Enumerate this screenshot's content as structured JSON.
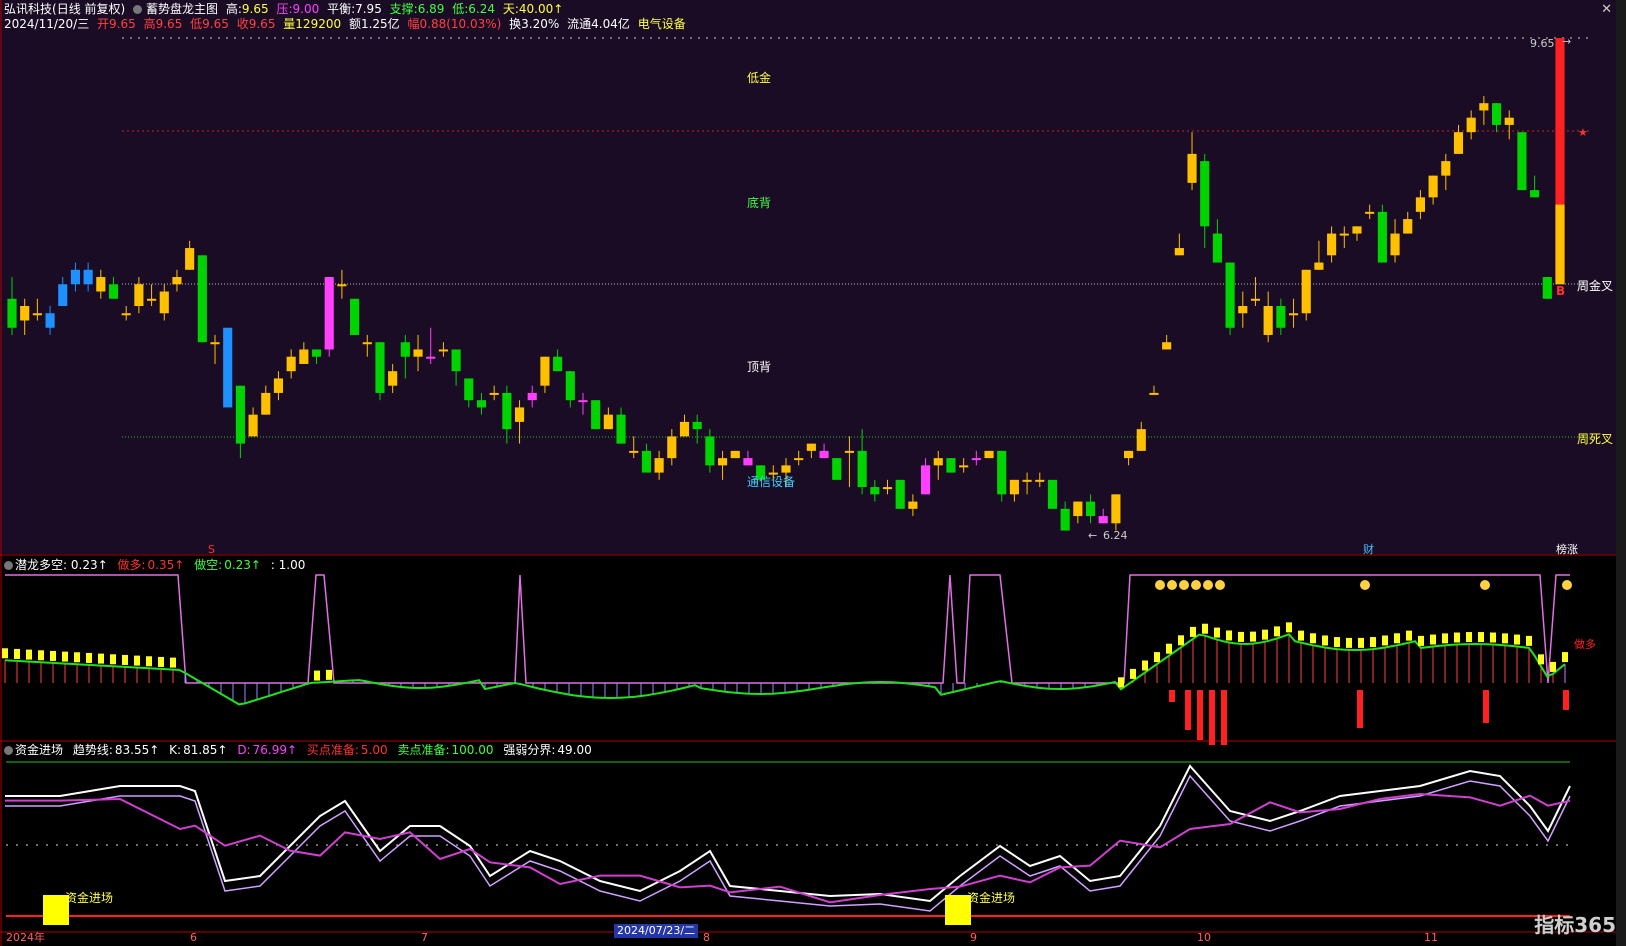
{
  "window": {
    "stock_name": "弘讯科技",
    "period": "(日线 前复权)",
    "indicator_name": "蓄势盘龙主图",
    "close_icon": "close-icon"
  },
  "header_line1": {
    "high_label": "高:",
    "high_value": "9.65",
    "press_label": "压:",
    "press_value": "9.00",
    "balance_label": "平衡:",
    "balance_value": "7.95",
    "support_label": "支撑:",
    "support_value": "6.89",
    "low_label": "低:",
    "low_value": "6.24",
    "sky_label": "天:",
    "sky_value": "40.00↑"
  },
  "header_line2": {
    "date": "2024/11/20/三",
    "open": "开9.65",
    "high": "高9.65",
    "low": "低9.65",
    "close": "收9.65",
    "volume": "量129200",
    "amount": "额1.25亿",
    "change": "幅0.88(10.03%)",
    "turnover": "换3.20%",
    "float": "流通4.04亿",
    "sector": "电气设备"
  },
  "main_labels": {
    "low_gold": "低金",
    "bottom_div": "底背",
    "top_div": "顶背",
    "sector_tag": "通信设备",
    "week_gold_cross": "周金叉",
    "week_death_cross": "周死叉",
    "max_price": "9.65",
    "min_price": "6.24",
    "buy_mark": "B",
    "low_mark": "S",
    "fin_mark": "财",
    "rank_mark": "榜涨"
  },
  "panel2": {
    "name": "潜龙多空",
    "value": ": 0.23↑",
    "long_label": "做多:",
    "long_value": "0.35↑",
    "short_label": "做空:",
    "short_value": "0.23↑",
    "ref_value": ": 1.00",
    "long_marker": "做多"
  },
  "panel3": {
    "name": "资金进场",
    "trend_label": "趋势线:",
    "trend_value": "83.55↑",
    "k_label": "K:",
    "k_value": "81.85↑",
    "d_label": "D:",
    "d_value": "76.99↑",
    "buy_label": "买点准备:",
    "buy_value": "5.00",
    "sell_label": "卖点准备:",
    "sell_value": "100.00",
    "strength_label": "强弱分界:",
    "strength_value": "49.00",
    "entry_label_1": "资金进场",
    "entry_label_2": "资金进场"
  },
  "x_axis": {
    "labels": [
      "2024年",
      "6",
      "7",
      "8",
      "9",
      "10",
      "11"
    ],
    "selected_date": "2024/07/23/二"
  },
  "watermark": "指标365",
  "colors": {
    "up_yellow": "#ffc000",
    "down_green": "#00d400",
    "magenta": "#ff40ff",
    "blue": "#1e90ff",
    "red": "#ff2020",
    "bg_main": "#1a0c24"
  },
  "chart_data": {
    "type": "candlestick",
    "price_range": [
      6.24,
      9.65
    ],
    "reference_lines": {
      "pressure": 9.0,
      "balance": 7.95,
      "support": 6.89
    },
    "candles_ohlc_approx": [
      [
        7.85,
        8.0,
        7.6,
        7.65
      ],
      [
        7.7,
        7.85,
        7.6,
        7.8
      ],
      [
        7.75,
        7.85,
        7.7,
        7.75
      ],
      [
        7.75,
        7.8,
        7.6,
        7.65
      ],
      [
        7.8,
        8.0,
        7.8,
        7.95
      ],
      [
        7.95,
        8.1,
        7.9,
        8.05
      ],
      [
        8.05,
        8.1,
        7.9,
        7.95
      ],
      [
        7.9,
        8.05,
        7.85,
        8.0
      ],
      [
        7.95,
        8.0,
        7.85,
        7.85
      ],
      [
        7.75,
        7.8,
        7.7,
        7.75
      ],
      [
        7.8,
        8.0,
        7.75,
        7.95
      ],
      [
        7.85,
        7.95,
        7.8,
        7.85
      ],
      [
        7.75,
        7.95,
        7.7,
        7.9
      ],
      [
        7.95,
        8.05,
        7.9,
        8.0
      ],
      [
        8.05,
        8.25,
        8.05,
        8.2
      ],
      [
        8.15,
        8.15,
        7.55,
        7.55
      ],
      [
        7.55,
        7.6,
        7.4,
        7.55
      ],
      [
        7.65,
        7.65,
        7.1,
        7.1
      ],
      [
        7.25,
        7.25,
        6.75,
        6.85
      ],
      [
        6.9,
        7.1,
        6.9,
        7.05
      ],
      [
        7.05,
        7.25,
        7.05,
        7.2
      ],
      [
        7.2,
        7.35,
        7.15,
        7.3
      ],
      [
        7.35,
        7.5,
        7.3,
        7.45
      ],
      [
        7.4,
        7.55,
        7.4,
        7.5
      ],
      [
        7.5,
        7.5,
        7.4,
        7.45
      ],
      [
        7.5,
        8.0,
        7.45,
        8.0
      ],
      [
        7.95,
        8.05,
        7.85,
        7.95
      ],
      [
        7.85,
        7.85,
        7.6,
        7.6
      ],
      [
        7.55,
        7.6,
        7.45,
        7.55
      ],
      [
        7.55,
        7.55,
        7.15,
        7.2
      ],
      [
        7.25,
        7.4,
        7.2,
        7.35
      ],
      [
        7.55,
        7.6,
        7.3,
        7.45
      ],
      [
        7.45,
        7.6,
        7.35,
        7.5
      ],
      [
        7.45,
        7.65,
        7.4,
        7.45
      ],
      [
        7.5,
        7.55,
        7.45,
        7.5
      ],
      [
        7.5,
        7.5,
        7.25,
        7.35
      ],
      [
        7.3,
        7.3,
        7.1,
        7.15
      ],
      [
        7.15,
        7.2,
        7.05,
        7.1
      ],
      [
        7.2,
        7.25,
        7.15,
        7.2
      ],
      [
        7.2,
        7.25,
        6.85,
        6.95
      ],
      [
        7.0,
        7.15,
        6.85,
        7.1
      ],
      [
        7.15,
        7.25,
        7.1,
        7.2
      ],
      [
        7.25,
        7.45,
        7.2,
        7.45
      ],
      [
        7.45,
        7.5,
        7.35,
        7.35
      ],
      [
        7.35,
        7.35,
        7.1,
        7.15
      ],
      [
        7.15,
        7.2,
        7.05,
        7.15
      ],
      [
        7.15,
        7.15,
        6.95,
        6.95
      ],
      [
        6.95,
        7.1,
        6.95,
        7.05
      ],
      [
        7.05,
        7.1,
        6.85,
        6.85
      ],
      [
        6.8,
        6.9,
        6.75,
        6.8
      ],
      [
        6.8,
        6.85,
        6.7,
        6.65
      ],
      [
        6.65,
        6.8,
        6.6,
        6.75
      ],
      [
        6.75,
        6.95,
        6.7,
        6.9
      ],
      [
        6.9,
        7.05,
        6.9,
        7.0
      ],
      [
        7.0,
        7.05,
        6.85,
        6.95
      ],
      [
        6.9,
        6.95,
        6.65,
        6.7
      ],
      [
        6.7,
        6.8,
        6.6,
        6.75
      ],
      [
        6.75,
        6.8,
        6.75,
        6.8
      ],
      [
        6.75,
        6.8,
        6.7,
        6.7
      ],
      [
        6.7,
        6.7,
        6.6,
        6.6
      ],
      [
        6.65,
        6.7,
        6.6,
        6.65
      ],
      [
        6.65,
        6.75,
        6.55,
        6.7
      ],
      [
        6.75,
        6.8,
        6.7,
        6.75
      ],
      [
        6.8,
        6.85,
        6.75,
        6.85
      ],
      [
        6.8,
        6.85,
        6.75,
        6.75
      ],
      [
        6.75,
        6.75,
        6.6,
        6.6
      ],
      [
        6.8,
        6.9,
        6.55,
        6.8
      ],
      [
        6.8,
        6.95,
        6.5,
        6.55
      ],
      [
        6.55,
        6.6,
        6.45,
        6.5
      ],
      [
        6.55,
        6.6,
        6.5,
        6.55
      ],
      [
        6.6,
        6.6,
        6.4,
        6.4
      ],
      [
        6.4,
        6.5,
        6.35,
        6.45
      ],
      [
        6.5,
        6.75,
        6.5,
        6.7
      ],
      [
        6.7,
        6.8,
        6.6,
        6.75
      ],
      [
        6.75,
        6.75,
        6.65,
        6.65
      ],
      [
        6.7,
        6.75,
        6.65,
        6.7
      ],
      [
        6.75,
        6.8,
        6.7,
        6.75
      ],
      [
        6.75,
        6.8,
        6.75,
        6.8
      ],
      [
        6.8,
        6.8,
        6.45,
        6.5
      ],
      [
        6.5,
        6.6,
        6.45,
        6.6
      ],
      [
        6.6,
        6.65,
        6.5,
        6.6
      ],
      [
        6.6,
        6.65,
        6.55,
        6.6
      ],
      [
        6.6,
        6.6,
        6.4,
        6.4
      ],
      [
        6.4,
        6.45,
        6.25,
        6.25
      ],
      [
        6.35,
        6.45,
        6.3,
        6.45
      ],
      [
        6.45,
        6.5,
        6.3,
        6.35
      ],
      [
        6.35,
        6.4,
        6.3,
        6.3
      ],
      [
        6.3,
        6.5,
        6.25,
        6.5
      ],
      [
        6.75,
        6.8,
        6.7,
        6.8
      ],
      [
        6.8,
        7.0,
        6.8,
        6.95
      ],
      [
        7.2,
        7.25,
        7.2,
        7.2
      ],
      [
        7.5,
        7.6,
        7.5,
        7.55
      ],
      [
        8.15,
        8.3,
        8.15,
        8.2
      ],
      [
        8.65,
        9.0,
        8.6,
        8.85
      ],
      [
        8.8,
        8.85,
        8.2,
        8.35
      ],
      [
        8.3,
        8.4,
        8.1,
        8.1
      ],
      [
        8.1,
        8.1,
        7.6,
        7.65
      ],
      [
        7.75,
        7.9,
        7.65,
        7.8
      ],
      [
        7.85,
        8.0,
        7.8,
        7.85
      ],
      [
        7.6,
        7.9,
        7.55,
        7.8
      ],
      [
        7.8,
        7.85,
        7.6,
        7.65
      ],
      [
        7.75,
        7.85,
        7.65,
        7.75
      ],
      [
        7.75,
        8.05,
        7.7,
        8.05
      ],
      [
        8.05,
        8.25,
        8.05,
        8.1
      ],
      [
        8.15,
        8.35,
        8.1,
        8.3
      ],
      [
        8.3,
        8.35,
        8.2,
        8.3
      ],
      [
        8.3,
        8.35,
        8.25,
        8.35
      ],
      [
        8.45,
        8.5,
        8.4,
        8.45
      ],
      [
        8.45,
        8.5,
        8.1,
        8.1
      ],
      [
        8.15,
        8.4,
        8.1,
        8.3
      ],
      [
        8.3,
        8.45,
        8.3,
        8.4
      ],
      [
        8.45,
        8.6,
        8.4,
        8.55
      ],
      [
        8.55,
        8.7,
        8.5,
        8.7
      ],
      [
        8.7,
        8.85,
        8.6,
        8.8
      ],
      [
        8.85,
        9.05,
        8.85,
        9.0
      ],
      [
        9.0,
        9.15,
        8.95,
        9.1
      ],
      [
        9.15,
        9.25,
        9.05,
        9.2
      ],
      [
        9.2,
        9.2,
        9.0,
        9.05
      ],
      [
        9.05,
        9.15,
        8.95,
        9.1
      ],
      [
        9.0,
        9.0,
        8.6,
        8.6
      ],
      [
        8.6,
        8.7,
        8.55,
        8.55
      ],
      [
        8.0,
        8.0,
        7.85,
        7.85
      ],
      [
        7.95,
        9.05,
        7.95,
        9.65
      ]
    ]
  }
}
